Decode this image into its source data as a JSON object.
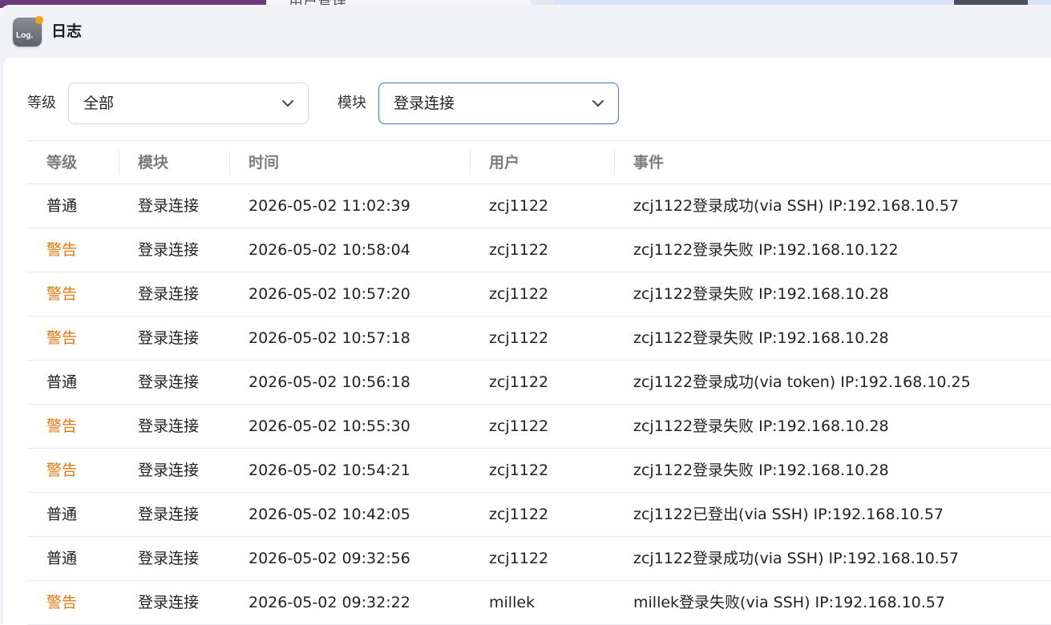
{
  "background": {
    "partial_text": "用户管理"
  },
  "window": {
    "title": "日志",
    "icon_text": "Log."
  },
  "filters": {
    "level_label": "等级",
    "level_value": "全部",
    "module_label": "模块",
    "module_value": "登录连接"
  },
  "colors": {
    "warning": "#e07a14",
    "accent": "#3b6fd6"
  },
  "table": {
    "headers": {
      "level": "等级",
      "module": "模块",
      "time": "时间",
      "user": "用户",
      "event": "事件"
    },
    "rows": [
      {
        "level": "普通",
        "warn": false,
        "module": "登录连接",
        "time": "2026-05-02 11:02:39",
        "user": "zcj1122",
        "event": "zcj1122登录成功(via SSH) IP:192.168.10.57"
      },
      {
        "level": "警告",
        "warn": true,
        "module": "登录连接",
        "time": "2026-05-02 10:58:04",
        "user": "zcj1122",
        "event": "zcj1122登录失败 IP:192.168.10.122"
      },
      {
        "level": "警告",
        "warn": true,
        "module": "登录连接",
        "time": "2026-05-02 10:57:20",
        "user": "zcj1122",
        "event": "zcj1122登录失败 IP:192.168.10.28"
      },
      {
        "level": "警告",
        "warn": true,
        "module": "登录连接",
        "time": "2026-05-02 10:57:18",
        "user": "zcj1122",
        "event": "zcj1122登录失败 IP:192.168.10.28"
      },
      {
        "level": "普通",
        "warn": false,
        "module": "登录连接",
        "time": "2026-05-02 10:56:18",
        "user": "zcj1122",
        "event": "zcj1122登录成功(via token) IP:192.168.10.25"
      },
      {
        "level": "警告",
        "warn": true,
        "module": "登录连接",
        "time": "2026-05-02 10:55:30",
        "user": "zcj1122",
        "event": "zcj1122登录失败 IP:192.168.10.28"
      },
      {
        "level": "警告",
        "warn": true,
        "module": "登录连接",
        "time": "2026-05-02 10:54:21",
        "user": "zcj1122",
        "event": "zcj1122登录失败 IP:192.168.10.28"
      },
      {
        "level": "普通",
        "warn": false,
        "module": "登录连接",
        "time": "2026-05-02 10:42:05",
        "user": "zcj1122",
        "event": "zcj1122已登出(via SSH) IP:192.168.10.57"
      },
      {
        "level": "普通",
        "warn": false,
        "module": "登录连接",
        "time": "2026-05-02 09:32:56",
        "user": "zcj1122",
        "event": "zcj1122登录成功(via SSH) IP:192.168.10.57"
      },
      {
        "level": "警告",
        "warn": true,
        "module": "登录连接",
        "time": "2026-05-02 09:32:22",
        "user": "millek",
        "event": "millek登录失败(via SSH) IP:192.168.10.57"
      }
    ]
  }
}
